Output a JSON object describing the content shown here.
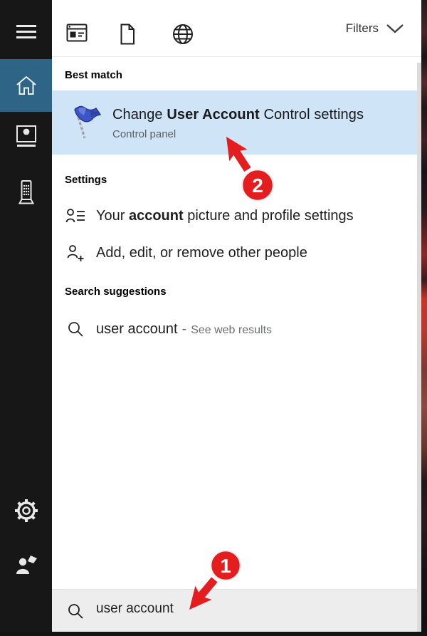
{
  "window": {
    "type": "windows-search-panel"
  },
  "topbar": {
    "filters_label": "Filters",
    "icons": [
      "apps-icon",
      "document-icon",
      "web-icon",
      "chevron-down-icon"
    ]
  },
  "sidebar": {
    "active": "home",
    "icons": [
      "menu-icon",
      "home-icon",
      "photos-icon",
      "mobile-device-icon",
      "settings-gear-icon",
      "feedback-icon"
    ]
  },
  "best_match": {
    "header": "Best match",
    "icon": "uac-flag-icon",
    "title_prefix": "Change ",
    "title_bold": "User Account",
    "title_suffix": " Control settings",
    "subtitle": "Control panel"
  },
  "settings_section": {
    "header": "Settings",
    "items": [
      {
        "icon": "account-card-icon",
        "prefix": "Your ",
        "bold": "account",
        "suffix": " picture and profile settings"
      },
      {
        "icon": "add-person-icon",
        "prefix": "",
        "bold": "",
        "suffix": "Add, edit, or remove other people"
      }
    ]
  },
  "suggestions_section": {
    "header": "Search suggestions",
    "icon": "search-icon",
    "query": "user account",
    "separator": "-",
    "hint": "See web results"
  },
  "search_box": {
    "icon": "search-icon",
    "value": "user account"
  },
  "annotations": {
    "step1_label": "1",
    "step2_label": "2"
  },
  "colors": {
    "sidebar_bg": "#171717",
    "sidebar_active_blue": "#2e6486",
    "best_match_highlight": "#cfe4f6",
    "annotation_red": "#e41e1e",
    "search_box_bg": "#ededed"
  }
}
